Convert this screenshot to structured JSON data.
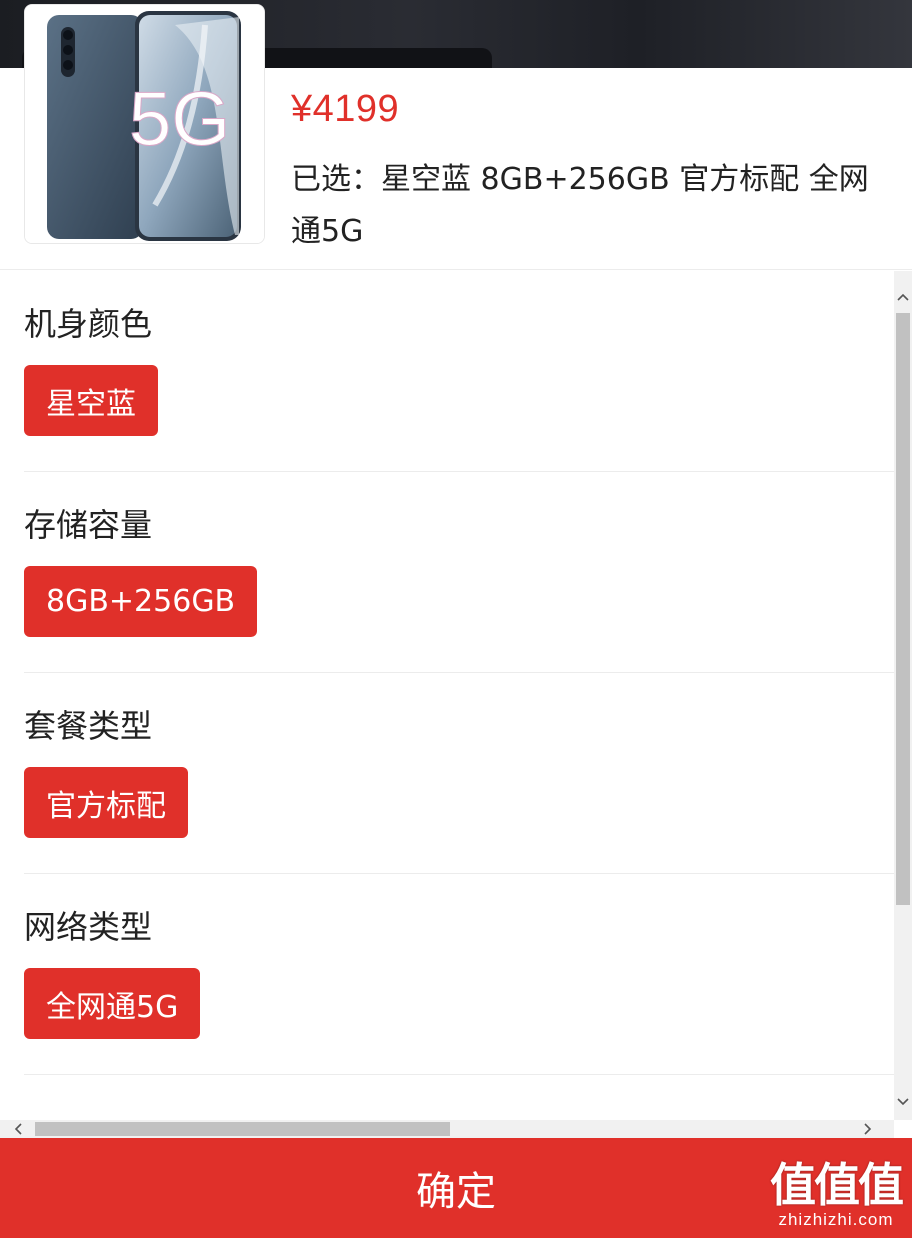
{
  "product": {
    "price": "¥4199",
    "selected_text": "已选：星空蓝 8GB+256GB 官方标配 全网通5G",
    "image_alt": "5G"
  },
  "options": [
    {
      "title": "机身颜色",
      "chip": "星空蓝"
    },
    {
      "title": "存储容量",
      "chip": "8GB+256GB"
    },
    {
      "title": "套餐类型",
      "chip": "官方标配"
    },
    {
      "title": "网络类型",
      "chip": "全网通5G"
    }
  ],
  "confirm": {
    "label": "确定"
  },
  "watermark": {
    "mark": "值值值",
    "url": "zhizhizhi.com"
  },
  "colors": {
    "accent": "#e0302a",
    "text": "#222222",
    "divider": "#ececec"
  },
  "icons": {
    "scroll_up": "chevron-up-icon",
    "scroll_down": "chevron-down-icon",
    "scroll_left": "chevron-left-icon",
    "scroll_right": "chevron-right-icon"
  }
}
